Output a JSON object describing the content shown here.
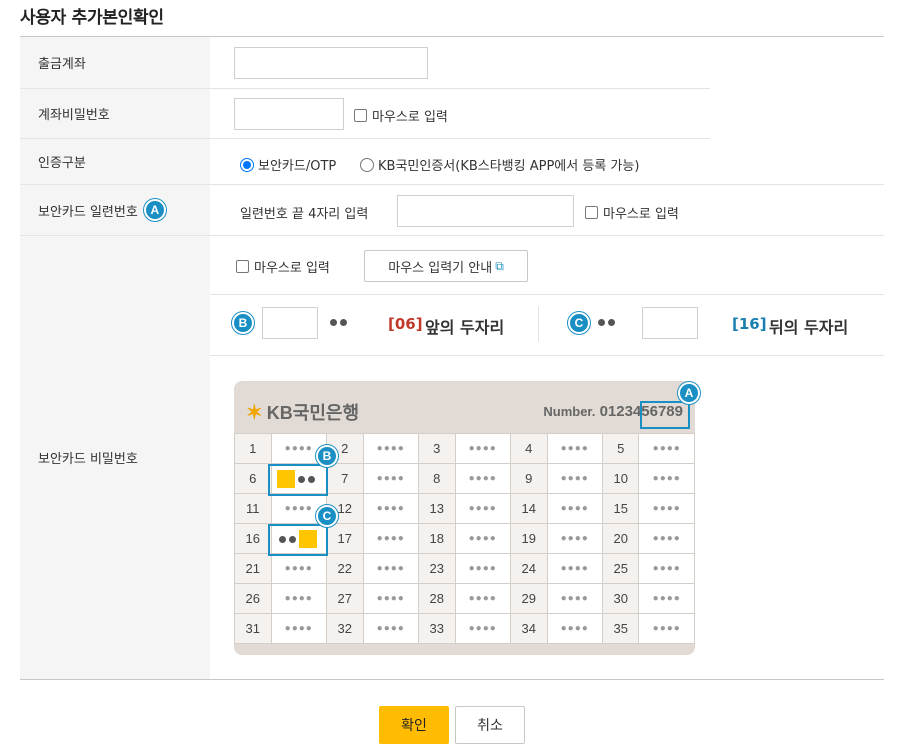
{
  "page_title": "사용자 추가본인확인",
  "rows": {
    "account": {
      "label": "출금계좌"
    },
    "password": {
      "label": "계좌비밀번호",
      "mouse_input": "마우스로 입력"
    },
    "auth_type": {
      "label": "인증구분",
      "option1": "보안카드/OTP",
      "option2": "KB국민인증서(KB스타뱅킹 APP에서 등록 가능)"
    },
    "serial": {
      "label": "보안카드 일련번호",
      "badge": "A",
      "prompt": "일련번호 끝 4자리 입력",
      "mouse_input": "마우스로 입력"
    },
    "card_pw": {
      "label": "보안카드 비밀번호",
      "mouse_input": "마우스로 입력",
      "guide_button": "마우스 입력기 안내",
      "badge_b": "B",
      "badge_c": "C",
      "first_num": "[06]",
      "first_text": "앞의 두자리",
      "second_num": "[16]",
      "second_text": "뒤의 두자리"
    }
  },
  "card": {
    "logo": "KB국민은행",
    "number_label": "Number.",
    "number_value": "0123456789",
    "mask": "●●●●",
    "badge_a": "A",
    "badge_b": "B",
    "badge_c": "C",
    "cells": [
      [
        "1",
        "2",
        "3",
        "4",
        "5"
      ],
      [
        "6",
        "7",
        "8",
        "9",
        "10"
      ],
      [
        "11",
        "12",
        "13",
        "14",
        "15"
      ],
      [
        "16",
        "17",
        "18",
        "19",
        "20"
      ],
      [
        "21",
        "22",
        "23",
        "24",
        "25"
      ],
      [
        "26",
        "27",
        "28",
        "29",
        "30"
      ],
      [
        "31",
        "32",
        "33",
        "34",
        "35"
      ]
    ]
  },
  "buttons": {
    "confirm": "확인",
    "cancel": "취소"
  },
  "colors": {
    "accent": "#1a8fc4",
    "primary_button": "#ffbc00",
    "red_num": "#c0392b",
    "blue_num": "#1a7fb0"
  }
}
